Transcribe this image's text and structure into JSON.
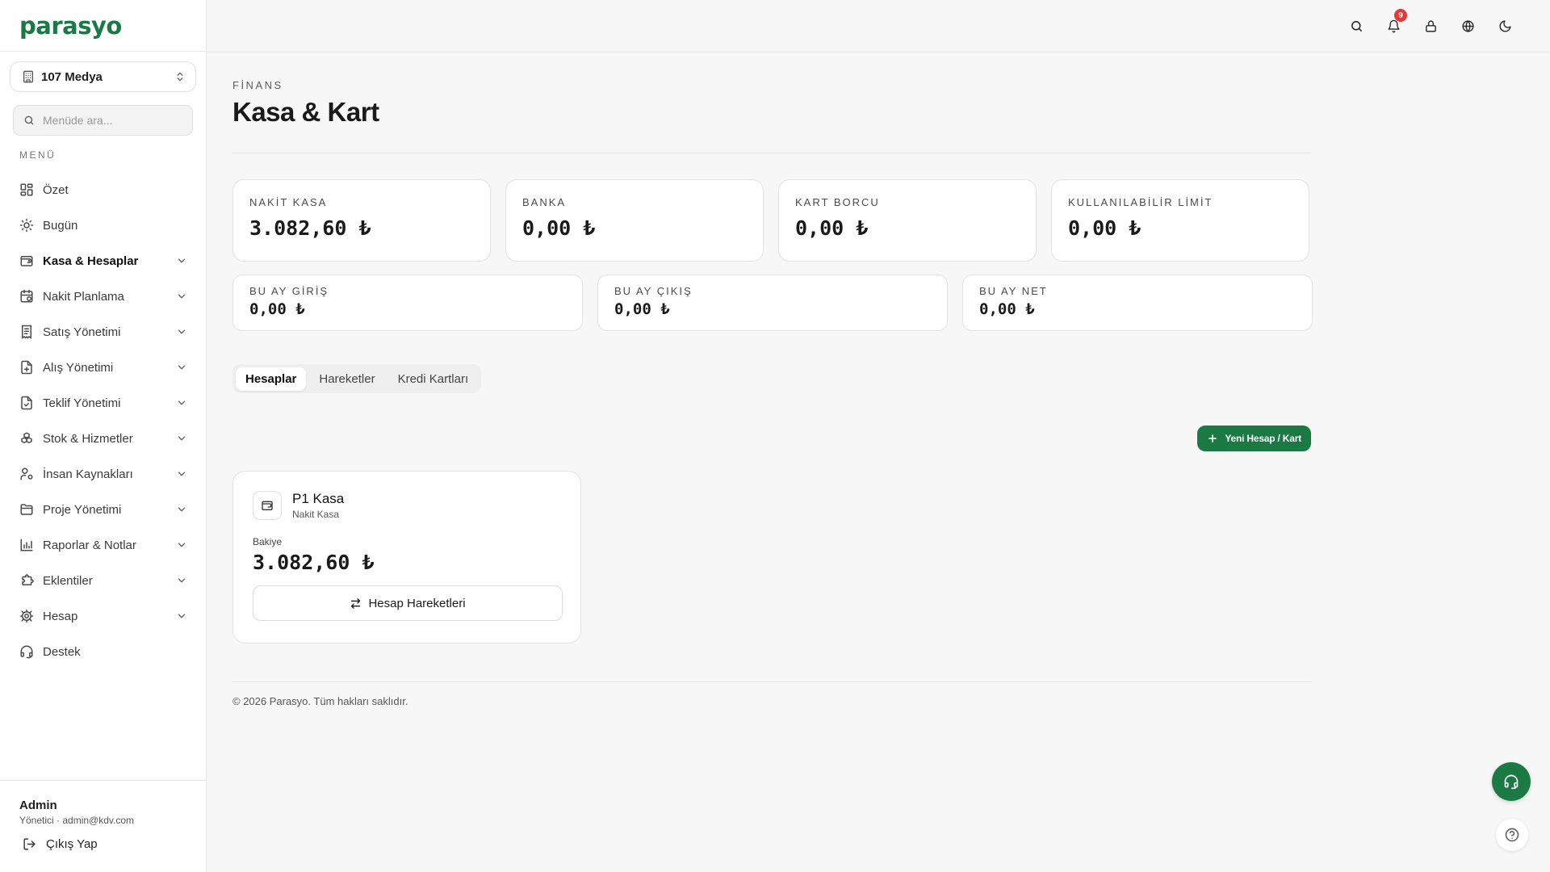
{
  "brand": {
    "logo_text": "parasyo",
    "color": "#1b7a44"
  },
  "sidebar": {
    "company": "107 Medya",
    "search_placeholder": "Menüde ara...",
    "menu_heading": "MENÜ",
    "items": [
      {
        "label": "Özet",
        "icon": "grid-icon"
      },
      {
        "label": "Bugün",
        "icon": "sun-icon"
      },
      {
        "label": "Kasa & Hesaplar",
        "icon": "wallet-icon",
        "active": true
      },
      {
        "label": "Nakit Planlama",
        "icon": "calendar-icon"
      },
      {
        "label": "Satış Yönetimi",
        "icon": "receipt-icon"
      },
      {
        "label": "Alış Yönetimi",
        "icon": "file-plus-icon"
      },
      {
        "label": "Teklif Yönetimi",
        "icon": "file-check-icon"
      },
      {
        "label": "Stok & Hizmetler",
        "icon": "boxes-icon"
      },
      {
        "label": "İnsan Kaynakları",
        "icon": "user-cog-icon"
      },
      {
        "label": "Proje Yönetimi",
        "icon": "folder-icon"
      },
      {
        "label": "Raporlar & Notlar",
        "icon": "bar-chart-icon"
      },
      {
        "label": "Eklentiler",
        "icon": "puzzle-icon"
      },
      {
        "label": "Hesap",
        "icon": "gear-icon"
      },
      {
        "label": "Destek",
        "icon": "headset-icon"
      }
    ],
    "user": {
      "name": "Admin",
      "meta": "Yönetici · admin@kdv.com"
    },
    "logout_label": "Çıkış Yap"
  },
  "topbar": {
    "notification_count": "9"
  },
  "page": {
    "eyebrow": "FİNANS",
    "title": "Kasa & Kart",
    "stats_top": [
      {
        "label": "NAKİT KASA",
        "value": "3.082,60 ₺"
      },
      {
        "label": "BANKA",
        "value": "0,00 ₺"
      },
      {
        "label": "KART BORCU",
        "value": "0,00 ₺"
      },
      {
        "label": "KULLANILABİLİR LİMİT",
        "value": "0,00 ₺"
      }
    ],
    "stats_bottom": [
      {
        "label": "BU AY GİRİŞ",
        "value": "0,00 ₺"
      },
      {
        "label": "BU AY ÇIKIŞ",
        "value": "0,00 ₺"
      },
      {
        "label": "BU AY NET",
        "value": "0,00 ₺"
      }
    ],
    "tabs": [
      "Hesaplar",
      "Hareketler",
      "Kredi Kartları"
    ],
    "new_button": "Yeni Hesap / Kart",
    "account": {
      "name": "P1 Kasa",
      "type": "Nakit Kasa",
      "balance_label": "Bakiye",
      "balance": "3.082,60 ₺",
      "button": "Hesap Hareketleri"
    },
    "footer": "© 2026 Parasyo. Tüm hakları saklıdır."
  }
}
